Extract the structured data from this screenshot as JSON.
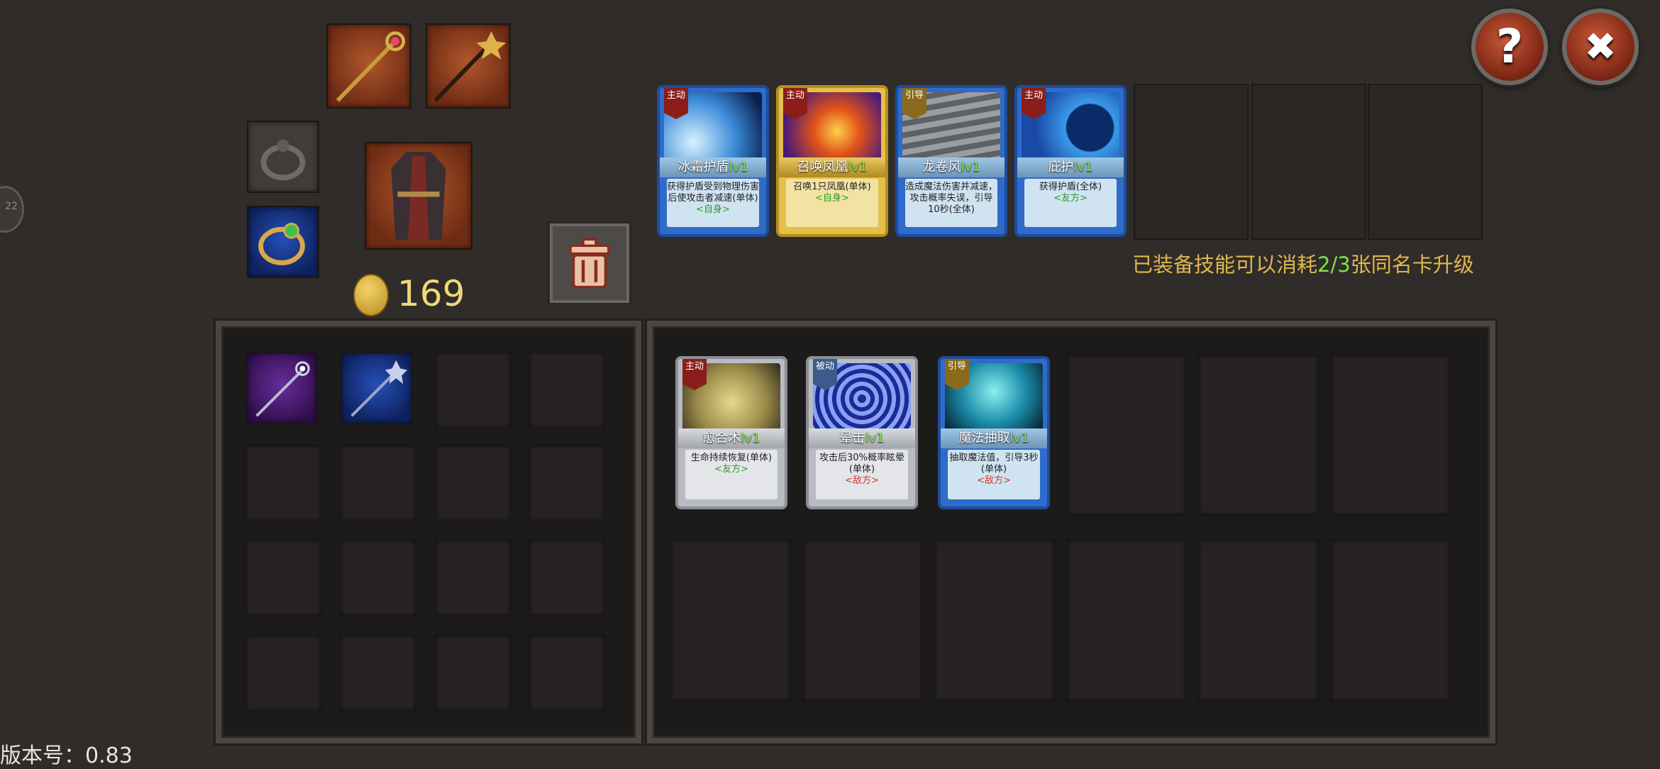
{
  "header": {
    "help_icon_glyph": "?",
    "close_icon_glyph": "✖"
  },
  "currency": {
    "gold": "169"
  },
  "equipped_skills": [
    {
      "tag": "主动",
      "name": "冰霜护盾",
      "lv": "lv1",
      "desc": "获得护盾受到物理伤害后使攻击者减速(单体)",
      "target": "<自身>",
      "target_type": "self",
      "frame": "blue",
      "art": "ice"
    },
    {
      "tag": "主动",
      "name": "召唤凤凰",
      "lv": "lv1",
      "desc": "召唤1只凤凰(单体)",
      "target": "<自身>",
      "target_type": "self",
      "frame": "gold",
      "art": "phoenix"
    },
    {
      "tag": "引导",
      "name": "龙卷风",
      "lv": "lv1",
      "desc": "造成魔法伤害并减速，攻击概率失误，引导10秒(全体)",
      "target": "",
      "target_type": "enemy",
      "frame": "blue",
      "art": "tornado"
    },
    {
      "tag": "主动",
      "name": "庇护",
      "lv": "lv1",
      "desc": "获得护盾(全体)",
      "target": "<友方>",
      "target_type": "ally",
      "frame": "blue",
      "art": "moon"
    }
  ],
  "upgrade_note": {
    "prefix": "已装备技能可以消耗",
    "count": "2/3",
    "suffix": "张同名卡升级"
  },
  "skill_inventory": [
    {
      "tag": "主动",
      "name": "愈合术",
      "lv": "lv1",
      "desc": "生命持续恢复(单体)",
      "target": "<友方>",
      "target_type": "ally",
      "frame": "silver",
      "art": "hand"
    },
    {
      "tag": "被动",
      "name": "晕击",
      "lv": "lv1",
      "desc": "攻击后30%概率眩晕(单体)",
      "target": "<敌方>",
      "target_type": "enemy",
      "frame": "silver",
      "art": "vortex"
    },
    {
      "tag": "引导",
      "name": "魔法抽取",
      "lv": "lv1",
      "desc": "抽取魔法值，引导3秒(单体)",
      "target": "<敌方>",
      "target_type": "enemy",
      "frame": "blue",
      "art": "claw"
    }
  ],
  "side_tab": "22",
  "version": {
    "label": "版本号：0.83"
  },
  "colors": {
    "accent_text": "#e0b64e",
    "level_green": "#7fe04a",
    "enemy_red": "#d23a2a",
    "ally_green": "#2a9b2a"
  }
}
